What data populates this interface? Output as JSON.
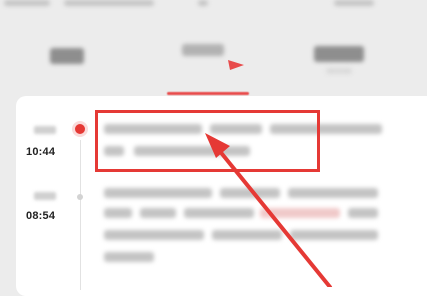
{
  "tabs": [
    {
      "label": ""
    },
    {
      "label": "",
      "active": true
    },
    {
      "label": "",
      "sublabel": ""
    }
  ],
  "timeline": [
    {
      "date": "",
      "time": "10:44",
      "text": "",
      "highlighted": true
    },
    {
      "date": "",
      "time": "08:54",
      "text": "",
      "highlighted": false
    }
  ],
  "annotation": {
    "color": "#e53935"
  },
  "colors": {
    "accent": "#e53935",
    "background": "#ececec",
    "card": "#ffffff"
  }
}
